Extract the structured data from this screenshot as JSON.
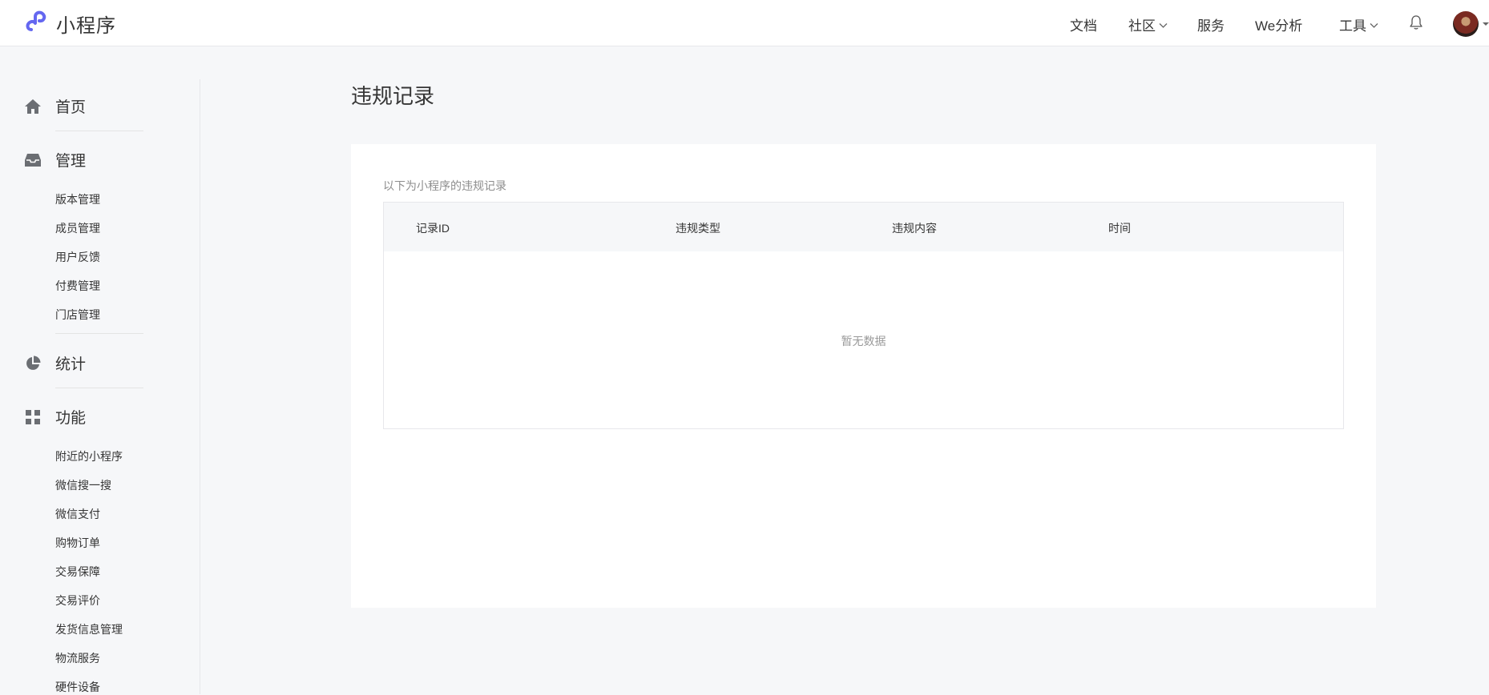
{
  "header": {
    "app_name": "小程序",
    "nav": {
      "docs": "文档",
      "community": "社区",
      "services": "服务",
      "analytics": "We分析",
      "tools": "工具"
    },
    "colors": {
      "brand": "#6467f0",
      "text": "#353535",
      "divider": "#e7e7eb"
    }
  },
  "sidebar": {
    "home": "首页",
    "manage": {
      "label": "管理",
      "items": [
        "版本管理",
        "成员管理",
        "用户反馈",
        "付费管理",
        "门店管理"
      ]
    },
    "stats": "统计",
    "features": {
      "label": "功能",
      "items": [
        "附近的小程序",
        "微信搜一搜",
        "微信支付",
        "购物订单",
        "交易保障",
        "交易评价",
        "发货信息管理",
        "物流服务",
        "硬件设备"
      ]
    }
  },
  "main": {
    "title": "违规记录",
    "description": "以下为小程序的违规记录",
    "table": {
      "columns": [
        "记录ID",
        "违规类型",
        "违规内容",
        "时间"
      ],
      "empty_text": "暂无数据"
    }
  },
  "icons": {
    "logo": "miniprogram-logo-icon",
    "home": "home-icon",
    "manage": "inbox-icon",
    "stats": "pie-chart-icon",
    "features": "grid-icon",
    "bell": "bell-icon",
    "chevron": "chevron-down-icon"
  }
}
